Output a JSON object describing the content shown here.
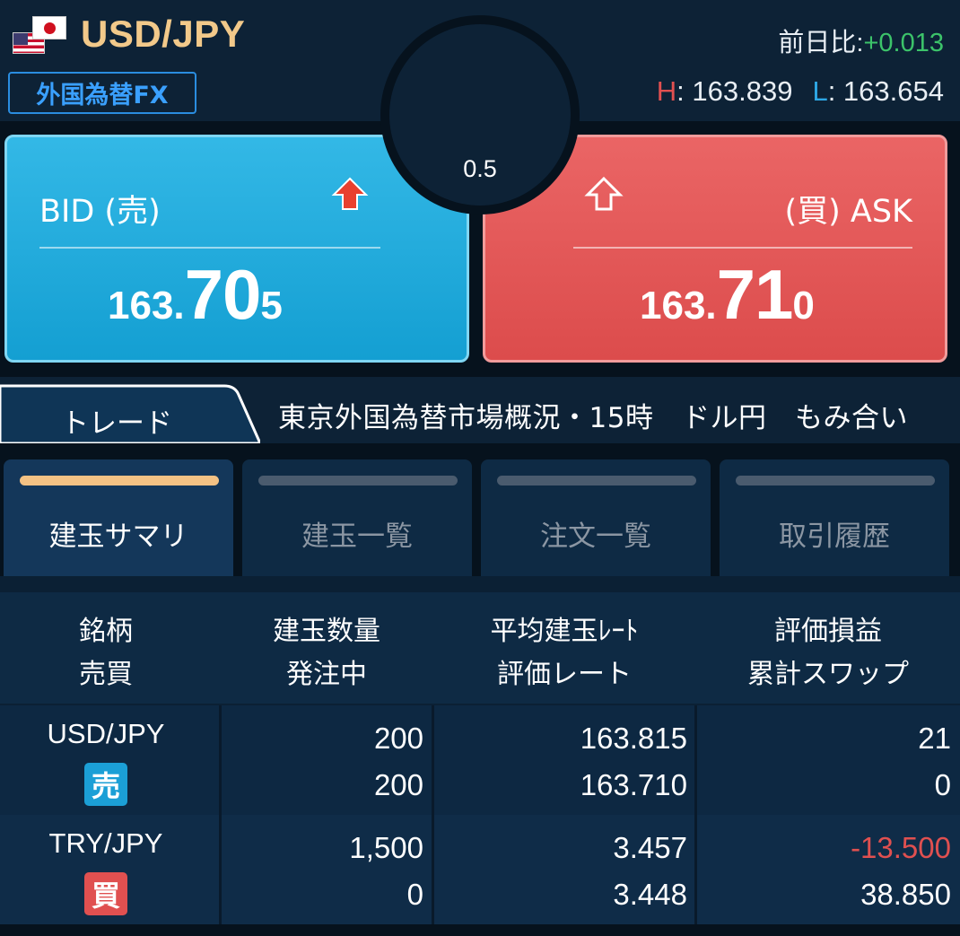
{
  "header": {
    "symbol": "USD/JPY",
    "product_badge": "外国為替FX",
    "change_label": "前日比:",
    "change_value": "+0.013",
    "high_label": "H",
    "high_value": ": 163.839",
    "low_label": "L",
    "low_value": ": 163.654"
  },
  "quote": {
    "spread": "0.5",
    "bid": {
      "label": "BID (売)",
      "small": "163.",
      "big": "70",
      "tail": "5",
      "direction": "up"
    },
    "ask": {
      "label": "(買) ASK",
      "small": "163.",
      "big": "71",
      "tail": "0",
      "direction": "up"
    }
  },
  "news": {
    "tab_label": "トレード",
    "headline": "東京外国為替市場概況・15時　ドル円　もみ合い"
  },
  "tabs": [
    {
      "label": "建玉サマリ",
      "active": true
    },
    {
      "label": "建玉一覧",
      "active": false
    },
    {
      "label": "注文一覧",
      "active": false
    },
    {
      "label": "取引履歴",
      "active": false
    }
  ],
  "table": {
    "headers": [
      {
        "line1": "銘柄",
        "line2": "売買"
      },
      {
        "line1": "建玉数量",
        "line2": "発注中"
      },
      {
        "line1": "平均建玉ﾚｰﾄ",
        "line2": "評価レート"
      },
      {
        "line1": "評価損益",
        "line2": "累計スワップ"
      }
    ],
    "rows": [
      {
        "pair": "USD/JPY",
        "side": "売",
        "qty": "200",
        "pending": "200",
        "avg_rate": "163.815",
        "eval_rate": "163.710",
        "pl": "21",
        "swap": "0"
      },
      {
        "pair": "TRY/JPY",
        "side": "買",
        "qty": "1,500",
        "pending": "0",
        "avg_rate": "3.457",
        "eval_rate": "3.448",
        "pl": "-13.500",
        "swap": "38.850"
      }
    ]
  },
  "colors": {
    "bid": "#1ea8dc",
    "ask": "#e25555",
    "positive": "#3cc36a",
    "negative": "#e05050",
    "accent": "#f4c284"
  }
}
